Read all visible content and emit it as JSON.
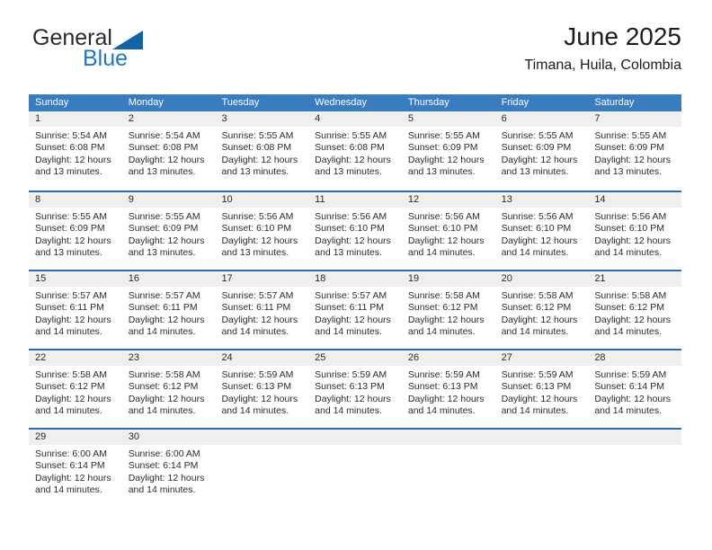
{
  "brand": {
    "name_top": "General",
    "name_bottom": "Blue",
    "triangle_icon": "triangle-icon",
    "color_primary": "#1464a5",
    "color_text": "#2b2b2b"
  },
  "header": {
    "title": "June 2025",
    "subtitle": "Timana, Huila, Colombia"
  },
  "calendar": {
    "header_bg": "#3a7cc0",
    "separator_color": "#2e6da8",
    "daynum_bg": "#efefef",
    "weekdays": [
      "Sunday",
      "Monday",
      "Tuesday",
      "Wednesday",
      "Thursday",
      "Friday",
      "Saturday"
    ],
    "weeks": [
      [
        {
          "day": "1",
          "lines": [
            "Sunrise: 5:54 AM",
            "Sunset: 6:08 PM",
            "Daylight: 12 hours",
            "and 13 minutes."
          ]
        },
        {
          "day": "2",
          "lines": [
            "Sunrise: 5:54 AM",
            "Sunset: 6:08 PM",
            "Daylight: 12 hours",
            "and 13 minutes."
          ]
        },
        {
          "day": "3",
          "lines": [
            "Sunrise: 5:55 AM",
            "Sunset: 6:08 PM",
            "Daylight: 12 hours",
            "and 13 minutes."
          ]
        },
        {
          "day": "4",
          "lines": [
            "Sunrise: 5:55 AM",
            "Sunset: 6:08 PM",
            "Daylight: 12 hours",
            "and 13 minutes."
          ]
        },
        {
          "day": "5",
          "lines": [
            "Sunrise: 5:55 AM",
            "Sunset: 6:09 PM",
            "Daylight: 12 hours",
            "and 13 minutes."
          ]
        },
        {
          "day": "6",
          "lines": [
            "Sunrise: 5:55 AM",
            "Sunset: 6:09 PM",
            "Daylight: 12 hours",
            "and 13 minutes."
          ]
        },
        {
          "day": "7",
          "lines": [
            "Sunrise: 5:55 AM",
            "Sunset: 6:09 PM",
            "Daylight: 12 hours",
            "and 13 minutes."
          ]
        }
      ],
      [
        {
          "day": "8",
          "lines": [
            "Sunrise: 5:55 AM",
            "Sunset: 6:09 PM",
            "Daylight: 12 hours",
            "and 13 minutes."
          ]
        },
        {
          "day": "9",
          "lines": [
            "Sunrise: 5:55 AM",
            "Sunset: 6:09 PM",
            "Daylight: 12 hours",
            "and 13 minutes."
          ]
        },
        {
          "day": "10",
          "lines": [
            "Sunrise: 5:56 AM",
            "Sunset: 6:10 PM",
            "Daylight: 12 hours",
            "and 13 minutes."
          ]
        },
        {
          "day": "11",
          "lines": [
            "Sunrise: 5:56 AM",
            "Sunset: 6:10 PM",
            "Daylight: 12 hours",
            "and 13 minutes."
          ]
        },
        {
          "day": "12",
          "lines": [
            "Sunrise: 5:56 AM",
            "Sunset: 6:10 PM",
            "Daylight: 12 hours",
            "and 14 minutes."
          ]
        },
        {
          "day": "13",
          "lines": [
            "Sunrise: 5:56 AM",
            "Sunset: 6:10 PM",
            "Daylight: 12 hours",
            "and 14 minutes."
          ]
        },
        {
          "day": "14",
          "lines": [
            "Sunrise: 5:56 AM",
            "Sunset: 6:10 PM",
            "Daylight: 12 hours",
            "and 14 minutes."
          ]
        }
      ],
      [
        {
          "day": "15",
          "lines": [
            "Sunrise: 5:57 AM",
            "Sunset: 6:11 PM",
            "Daylight: 12 hours",
            "and 14 minutes."
          ]
        },
        {
          "day": "16",
          "lines": [
            "Sunrise: 5:57 AM",
            "Sunset: 6:11 PM",
            "Daylight: 12 hours",
            "and 14 minutes."
          ]
        },
        {
          "day": "17",
          "lines": [
            "Sunrise: 5:57 AM",
            "Sunset: 6:11 PM",
            "Daylight: 12 hours",
            "and 14 minutes."
          ]
        },
        {
          "day": "18",
          "lines": [
            "Sunrise: 5:57 AM",
            "Sunset: 6:11 PM",
            "Daylight: 12 hours",
            "and 14 minutes."
          ]
        },
        {
          "day": "19",
          "lines": [
            "Sunrise: 5:58 AM",
            "Sunset: 6:12 PM",
            "Daylight: 12 hours",
            "and 14 minutes."
          ]
        },
        {
          "day": "20",
          "lines": [
            "Sunrise: 5:58 AM",
            "Sunset: 6:12 PM",
            "Daylight: 12 hours",
            "and 14 minutes."
          ]
        },
        {
          "day": "21",
          "lines": [
            "Sunrise: 5:58 AM",
            "Sunset: 6:12 PM",
            "Daylight: 12 hours",
            "and 14 minutes."
          ]
        }
      ],
      [
        {
          "day": "22",
          "lines": [
            "Sunrise: 5:58 AM",
            "Sunset: 6:12 PM",
            "Daylight: 12 hours",
            "and 14 minutes."
          ]
        },
        {
          "day": "23",
          "lines": [
            "Sunrise: 5:58 AM",
            "Sunset: 6:12 PM",
            "Daylight: 12 hours",
            "and 14 minutes."
          ]
        },
        {
          "day": "24",
          "lines": [
            "Sunrise: 5:59 AM",
            "Sunset: 6:13 PM",
            "Daylight: 12 hours",
            "and 14 minutes."
          ]
        },
        {
          "day": "25",
          "lines": [
            "Sunrise: 5:59 AM",
            "Sunset: 6:13 PM",
            "Daylight: 12 hours",
            "and 14 minutes."
          ]
        },
        {
          "day": "26",
          "lines": [
            "Sunrise: 5:59 AM",
            "Sunset: 6:13 PM",
            "Daylight: 12 hours",
            "and 14 minutes."
          ]
        },
        {
          "day": "27",
          "lines": [
            "Sunrise: 5:59 AM",
            "Sunset: 6:13 PM",
            "Daylight: 12 hours",
            "and 14 minutes."
          ]
        },
        {
          "day": "28",
          "lines": [
            "Sunrise: 5:59 AM",
            "Sunset: 6:14 PM",
            "Daylight: 12 hours",
            "and 14 minutes."
          ]
        }
      ],
      [
        {
          "day": "29",
          "lines": [
            "Sunrise: 6:00 AM",
            "Sunset: 6:14 PM",
            "Daylight: 12 hours",
            "and 14 minutes."
          ]
        },
        {
          "day": "30",
          "lines": [
            "Sunrise: 6:00 AM",
            "Sunset: 6:14 PM",
            "Daylight: 12 hours",
            "and 14 minutes."
          ]
        },
        {
          "day": "",
          "lines": []
        },
        {
          "day": "",
          "lines": []
        },
        {
          "day": "",
          "lines": []
        },
        {
          "day": "",
          "lines": []
        },
        {
          "day": "",
          "lines": []
        }
      ]
    ]
  }
}
